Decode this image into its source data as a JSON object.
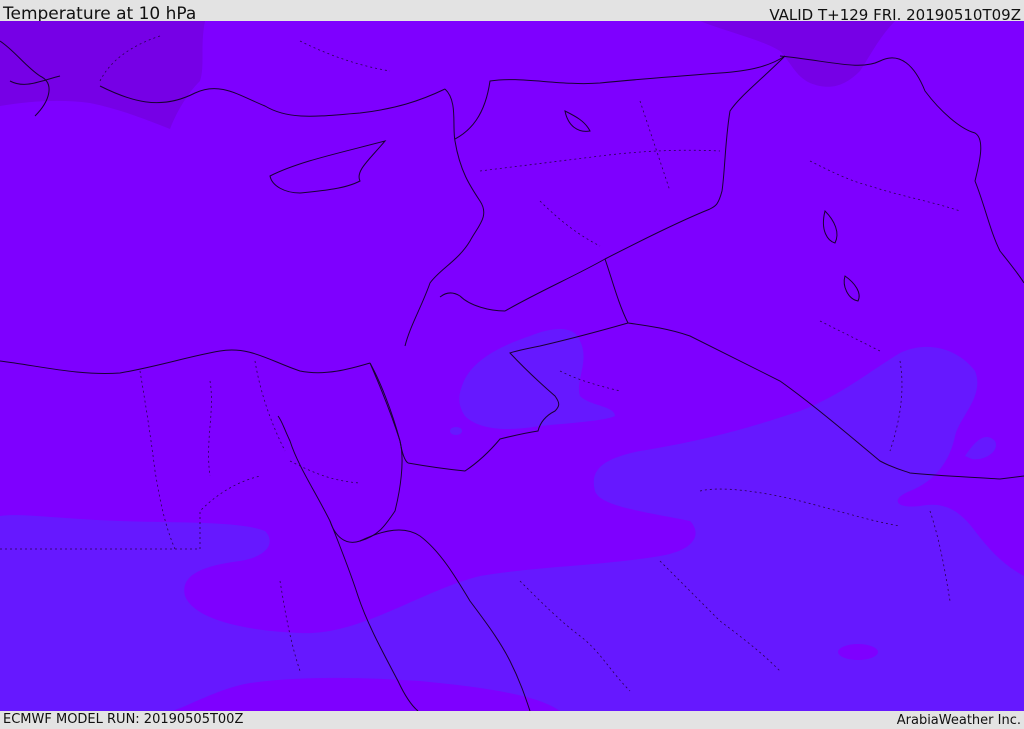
{
  "header": {
    "title": "Temperature at 10 hPa",
    "valid": "VALID T+129 FRI. 20190510T09Z"
  },
  "footer": {
    "model_run": "ECMWF MODEL RUN: 20190505T00Z",
    "credit": "ArabiaWeather Inc."
  },
  "map": {
    "field": "temperature",
    "level": "10 hPa",
    "region": "Eastern Mediterranean / Middle East",
    "colors": {
      "base": "#7e00ff",
      "cooler_band": "#6618ff",
      "warmer_patch": "#7a00e0",
      "coastline": "#1a0033"
    }
  }
}
